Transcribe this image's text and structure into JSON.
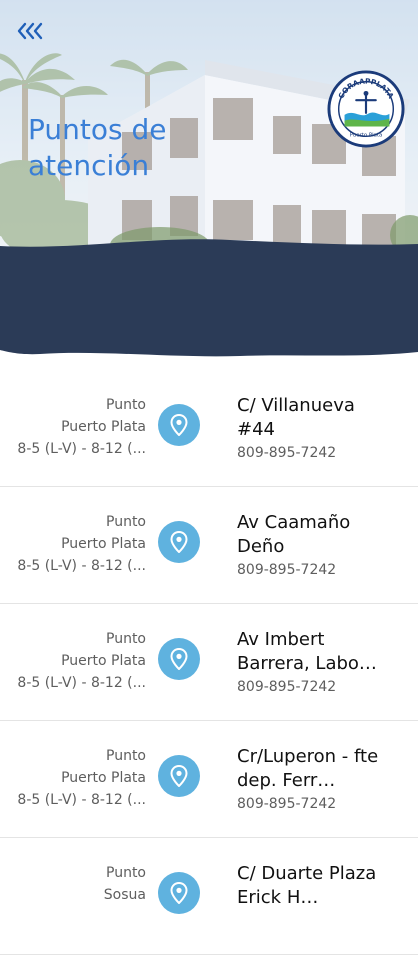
{
  "header": {
    "title": "Puntos de atención",
    "back_icon": "triple-chevron-left-icon",
    "logo": {
      "text_top": "CORAAPPLATA",
      "text_bottom": "Puerto Plata",
      "colors": {
        "ring": "#1b3b7a",
        "water": "#2aa0d8",
        "green": "#5fb54a"
      }
    }
  },
  "colors": {
    "accent": "#3a7fd6",
    "navy": "#2b3b57",
    "pin": "#5fb2df"
  },
  "locations": [
    {
      "type": "Punto",
      "city": "Puerto Plata",
      "hours": "8-5 (L-V) - 8-12 (...",
      "address": "C/ Villanueva #44",
      "phone": "809-895-7242"
    },
    {
      "type": "Punto",
      "city": "Puerto Plata",
      "hours": "8-5 (L-V) - 8-12 (...",
      "address": "Av Caamaño Deño",
      "phone": "809-895-7242"
    },
    {
      "type": "Punto",
      "city": "Puerto Plata",
      "hours": "8-5 (L-V) - 8-12 (...",
      "address": "Av Imbert Barrera, Labo…",
      "phone": "809-895-7242"
    },
    {
      "type": "Punto",
      "city": "Puerto Plata",
      "hours": "8-5 (L-V) - 8-12 (...",
      "address": "Cr/Luperon - fte dep. Ferr…",
      "phone": "809-895-7242"
    },
    {
      "type": "Punto",
      "city": "Sosua",
      "hours": "",
      "address": "C/ Duarte Plaza Erick H…",
      "phone": ""
    }
  ]
}
